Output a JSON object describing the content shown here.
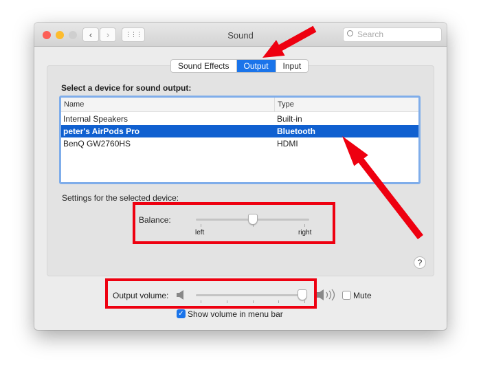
{
  "window": {
    "title": "Sound",
    "search_placeholder": "Search"
  },
  "toolbar": {
    "back": "‹",
    "forward": "›",
    "grid": "⋮⋮⋮"
  },
  "tabs": [
    {
      "label": "Sound Effects",
      "selected": false
    },
    {
      "label": "Output",
      "selected": true
    },
    {
      "label": "Input",
      "selected": false
    }
  ],
  "output": {
    "heading": "Select a device for sound output:",
    "columns": [
      "Name",
      "Type"
    ],
    "devices": [
      {
        "name": "Internal Speakers",
        "type": "Built-in"
      },
      {
        "name": "peter's AirPods Pro",
        "type": "Bluetooth",
        "selected": true
      },
      {
        "name": "BenQ GW2760HS",
        "type": "HDMI"
      }
    ],
    "settings_label": "Settings for the selected device:",
    "balance": {
      "label": "Balance:",
      "left": "left",
      "right": "right",
      "value": 0.5
    }
  },
  "help": "?",
  "volume": {
    "label": "Output volume:",
    "value": 0.97,
    "mute_label": "Mute",
    "muted": false,
    "show_in_menu_bar_label": "Show volume in menu bar",
    "show_in_menu_bar": true
  },
  "colors": {
    "accent": "#1a74ea",
    "annotation": "#ee0010"
  }
}
